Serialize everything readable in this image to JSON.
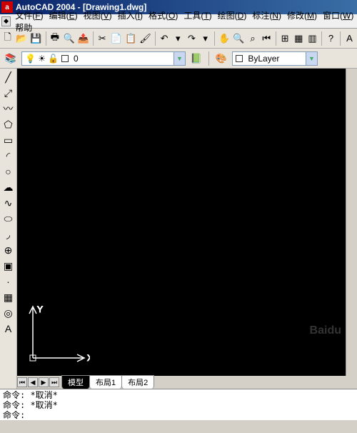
{
  "title": "AutoCAD 2004 - [Drawing1.dwg]",
  "app_icon_letter": "a",
  "menu": [
    {
      "label": "文件",
      "accel": "F"
    },
    {
      "label": "编辑",
      "accel": "E"
    },
    {
      "label": "视图",
      "accel": "V"
    },
    {
      "label": "插入",
      "accel": "I"
    },
    {
      "label": "格式",
      "accel": "O"
    },
    {
      "label": "工具",
      "accel": "T"
    },
    {
      "label": "绘图",
      "accel": "D"
    },
    {
      "label": "标注",
      "accel": "N"
    },
    {
      "label": "修改",
      "accel": "M"
    },
    {
      "label": "窗口",
      "accel": "W"
    },
    {
      "label": "帮助"
    }
  ],
  "std_toolbar": [
    "new",
    "open",
    "save",
    "",
    "plot",
    "preview",
    "publish",
    "",
    "cut",
    "copy",
    "paste",
    "match",
    "",
    "undo",
    "undo-drop",
    "redo",
    "redo-drop",
    "",
    "pan",
    "zoom-rt",
    "zoom-win",
    "zoom-prev",
    "",
    "properties",
    "designcenter",
    "toolpalette",
    "",
    "help",
    "",
    "text-style"
  ],
  "layer": {
    "icons": [
      "on",
      "freeze",
      "lock",
      "color"
    ],
    "current": "0",
    "bylayer": "ByLayer"
  },
  "draw_tools": [
    "line",
    "xline",
    "pline",
    "polygon",
    "rectangle",
    "arc",
    "circle",
    "revcloud",
    "spline",
    "ellipse",
    "ellipse-arc",
    "insert",
    "block",
    "point",
    "hatch",
    "region",
    "text"
  ],
  "tabs": {
    "active": "模型",
    "others": [
      "布局1",
      "布局2"
    ]
  },
  "ucs": {
    "x": "X",
    "y": "Y"
  },
  "command": {
    "line1_prefix": "命令: ",
    "line1_text": "*取消*",
    "line2_prefix": "命令: ",
    "line2_text": "*取消*",
    "line3_prefix": "命令:"
  },
  "toolbar_glyphs": {
    "new": "🗋",
    "open": "📂",
    "save": "💾",
    "plot": "🖶",
    "preview": "🔍",
    "publish": "📤",
    "cut": "✂",
    "copy": "📄",
    "paste": "📋",
    "match": "🖌",
    "undo": "↶",
    "undo-drop": "▾",
    "redo": "↷",
    "redo-drop": "▾",
    "pan": "✋",
    "zoom-rt": "🔍",
    "zoom-win": "⌕",
    "zoom-prev": "⏮",
    "properties": "⊞",
    "designcenter": "▦",
    "toolpalette": "▥",
    "help": "?",
    "text-style": "A"
  },
  "draw_glyphs": {
    "line": "╱",
    "xline": "⤢",
    "pline": "〰",
    "polygon": "⬠",
    "rectangle": "▭",
    "arc": "◜",
    "circle": "○",
    "revcloud": "☁",
    "spline": "∿",
    "ellipse": "⬭",
    "ellipse-arc": "◞",
    "insert": "⊕",
    "block": "▣",
    "point": "·",
    "hatch": "▦",
    "region": "◎",
    "text": "A"
  }
}
